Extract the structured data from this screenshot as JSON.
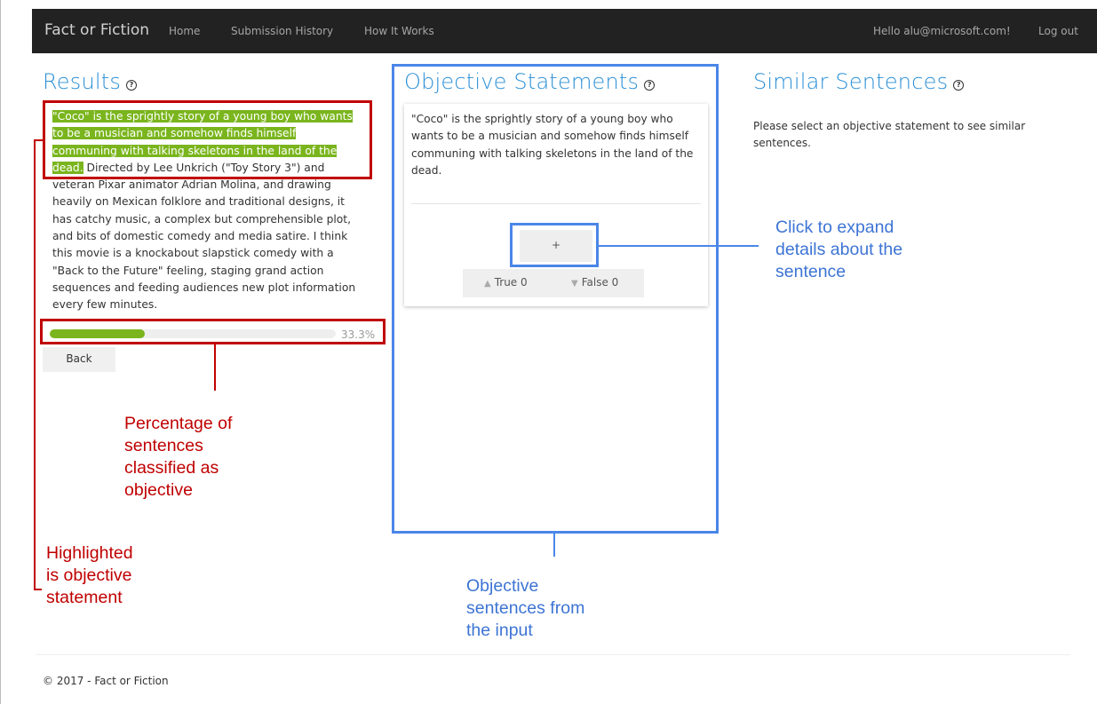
{
  "nav": {
    "brand": "Fact or Fiction",
    "home": "Home",
    "history": "Submission History",
    "how": "How It Works",
    "greeting": "Hello alu@microsoft.com!",
    "logout": "Log out"
  },
  "results": {
    "title": "Results",
    "highlighted_line1": "\"Coco\" is the sprightly story of a young boy who wants",
    "highlighted_line2": "to be a musician and somehow finds himself",
    "highlighted_line3": "communing with talking skeletons in the land of the",
    "highlighted_line4": "dead.",
    "rest_line4": " Directed by Lee Unkrich (\"Toy Story 3\") and",
    "rest_line5": "veteran Pixar animator Adrian Molina, and drawing",
    "rest_line6": "heavily on Mexican folklore and traditional designs, it",
    "rest_line7": "has catchy music, a complex but comprehensible plot,",
    "rest_line8": "and bits of domestic comedy and media satire. I think",
    "rest_line9": "this movie is a knockabout slapstick comedy with a",
    "rest_line10": "\"Back to the Future\" feeling, staging grand action",
    "rest_line11": "sequences and feeding audiences new plot information",
    "rest_line12": "every few minutes.",
    "progress_percent": 33.3,
    "progress_label": "33.3%",
    "back_label": "Back"
  },
  "objective": {
    "title": "Objective Statements",
    "statement": "\"Coco\" is the sprightly story of a young boy who wants to be a musician and somehow finds himself communing with talking skeletons in the land of the dead.",
    "expand_label": "+",
    "true_label": "True 0",
    "false_label": "False 0"
  },
  "similar": {
    "title": "Similar Sentences",
    "message": "Please select an objective statement to see similar sentences."
  },
  "annotations": {
    "percentage_line1": "Percentage of",
    "percentage_line2": "sentences",
    "percentage_line3": "classified as",
    "percentage_line4": "objective",
    "highlighted_line1": "Highlighted",
    "highlighted_line2": "is objective",
    "highlighted_line3": "statement",
    "objective_line1": "Objective",
    "objective_line2": "sentences from",
    "objective_line3": "the input",
    "click_line1": "Click to expand",
    "click_line2": "details about the",
    "click_line3": "sentence"
  },
  "footer": {
    "text": "© 2017 - Fact or Fiction"
  },
  "colors": {
    "accent": "#2a8fd6",
    "highlight": "#7ab51d",
    "annotation_red": "#c00000",
    "annotation_blue": "#4a86e8"
  }
}
